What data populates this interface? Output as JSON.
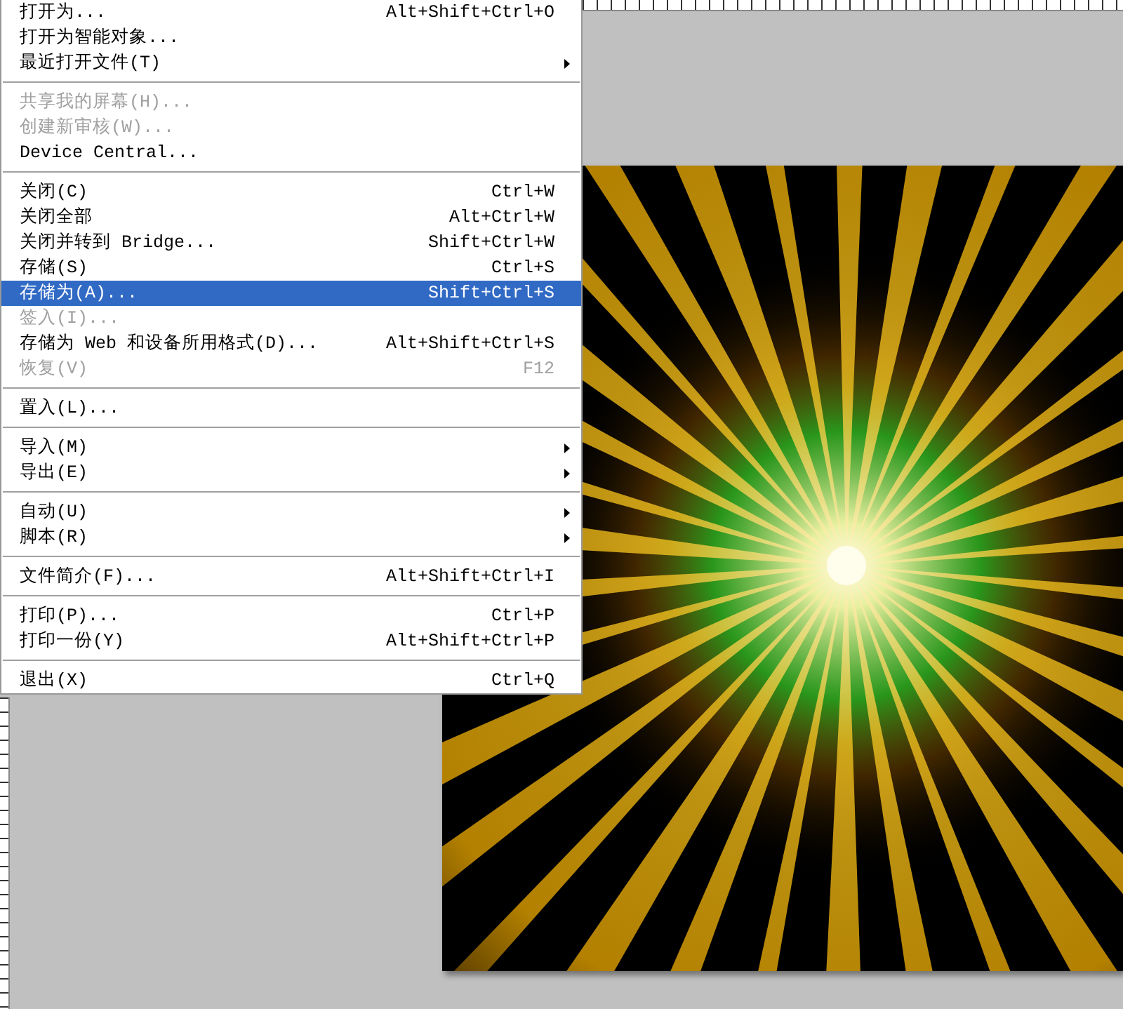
{
  "menu": [
    {
      "kind": "item",
      "label": "打开为...",
      "shortcut": "Alt+Shift+Ctrl+O",
      "submenu": false,
      "disabled": false,
      "selected": false
    },
    {
      "kind": "item",
      "label": "打开为智能对象...",
      "submenu": false,
      "disabled": false,
      "selected": false
    },
    {
      "kind": "item",
      "label": "最近打开文件(T)",
      "submenu": true,
      "disabled": false,
      "selected": false
    },
    {
      "kind": "separator"
    },
    {
      "kind": "item",
      "label": "共享我的屏幕(H)...",
      "submenu": false,
      "disabled": true,
      "selected": false
    },
    {
      "kind": "item",
      "label": "创建新审核(W)...",
      "submenu": false,
      "disabled": true,
      "selected": false
    },
    {
      "kind": "item",
      "label": "Device Central...",
      "submenu": false,
      "disabled": false,
      "selected": false
    },
    {
      "kind": "separator"
    },
    {
      "kind": "item",
      "label": "关闭(C)",
      "shortcut": "Ctrl+W",
      "submenu": false,
      "disabled": false,
      "selected": false
    },
    {
      "kind": "item",
      "label": "关闭全部",
      "shortcut": "Alt+Ctrl+W",
      "submenu": false,
      "disabled": false,
      "selected": false
    },
    {
      "kind": "item",
      "label": "关闭并转到 Bridge...",
      "shortcut": "Shift+Ctrl+W",
      "submenu": false,
      "disabled": false,
      "selected": false
    },
    {
      "kind": "item",
      "label": "存储(S)",
      "shortcut": "Ctrl+S",
      "submenu": false,
      "disabled": false,
      "selected": false
    },
    {
      "kind": "item",
      "label": "存储为(A)...",
      "shortcut": "Shift+Ctrl+S",
      "submenu": false,
      "disabled": false,
      "selected": true
    },
    {
      "kind": "item",
      "label": "签入(I)...",
      "submenu": false,
      "disabled": true,
      "selected": false
    },
    {
      "kind": "item",
      "label": "存储为 Web 和设备所用格式(D)...",
      "shortcut": "Alt+Shift+Ctrl+S",
      "submenu": false,
      "disabled": false,
      "selected": false
    },
    {
      "kind": "item",
      "label": "恢复(V)",
      "shortcut": "F12",
      "submenu": false,
      "disabled": true,
      "selected": false
    },
    {
      "kind": "separator"
    },
    {
      "kind": "item",
      "label": "置入(L)...",
      "submenu": false,
      "disabled": false,
      "selected": false
    },
    {
      "kind": "separator"
    },
    {
      "kind": "item",
      "label": "导入(M)",
      "submenu": true,
      "disabled": false,
      "selected": false
    },
    {
      "kind": "item",
      "label": "导出(E)",
      "submenu": true,
      "disabled": false,
      "selected": false
    },
    {
      "kind": "separator"
    },
    {
      "kind": "item",
      "label": "自动(U)",
      "submenu": true,
      "disabled": false,
      "selected": false
    },
    {
      "kind": "item",
      "label": "脚本(R)",
      "submenu": true,
      "disabled": false,
      "selected": false
    },
    {
      "kind": "separator"
    },
    {
      "kind": "item",
      "label": "文件简介(F)...",
      "shortcut": "Alt+Shift+Ctrl+I",
      "submenu": false,
      "disabled": false,
      "selected": false
    },
    {
      "kind": "separator"
    },
    {
      "kind": "item",
      "label": "打印(P)...",
      "shortcut": "Ctrl+P",
      "submenu": false,
      "disabled": false,
      "selected": false
    },
    {
      "kind": "item",
      "label": "打印一份(Y)",
      "shortcut": "Alt+Shift+Ctrl+P",
      "submenu": false,
      "disabled": false,
      "selected": false
    },
    {
      "kind": "separator"
    },
    {
      "kind": "item",
      "label": "退出(X)",
      "shortcut": "Ctrl+Q",
      "submenu": false,
      "disabled": false,
      "selected": false
    }
  ]
}
